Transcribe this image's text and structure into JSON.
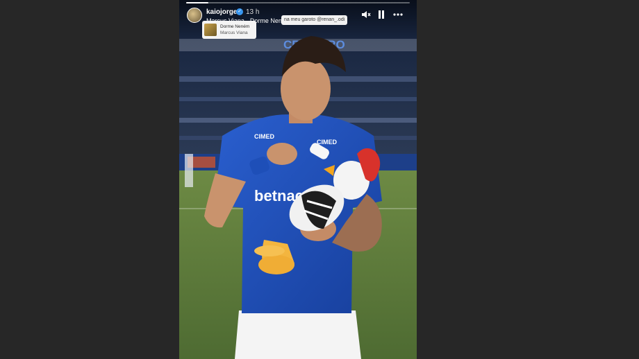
{
  "story": {
    "username": "kaiojorge",
    "time_ago": "13 h",
    "music_line": "Marcus Viana · Dorme Neném",
    "caption_chip": "na meu garoto @renan_.odi",
    "music_sticker": {
      "title": "Dorme Neném",
      "artist": "Marcus Viana"
    },
    "progress": 0.1,
    "icons": {
      "mute": "speaker-muted-icon",
      "pause": "pause-icon",
      "more": "more-options-icon",
      "verified": "verified-badge-icon"
    },
    "photo": {
      "stadium_banner": "CRUZEIRO",
      "jersey_sponsor_left": "CIMED",
      "jersey_sponsor_right": "CIMED",
      "jersey_main_sponsor": "betnac"
    }
  },
  "colors": {
    "background": "#272727",
    "jersey_blue": "#1f4fb8",
    "pitch_green": "#5c7c3c",
    "verified_blue": "#3897f0"
  }
}
